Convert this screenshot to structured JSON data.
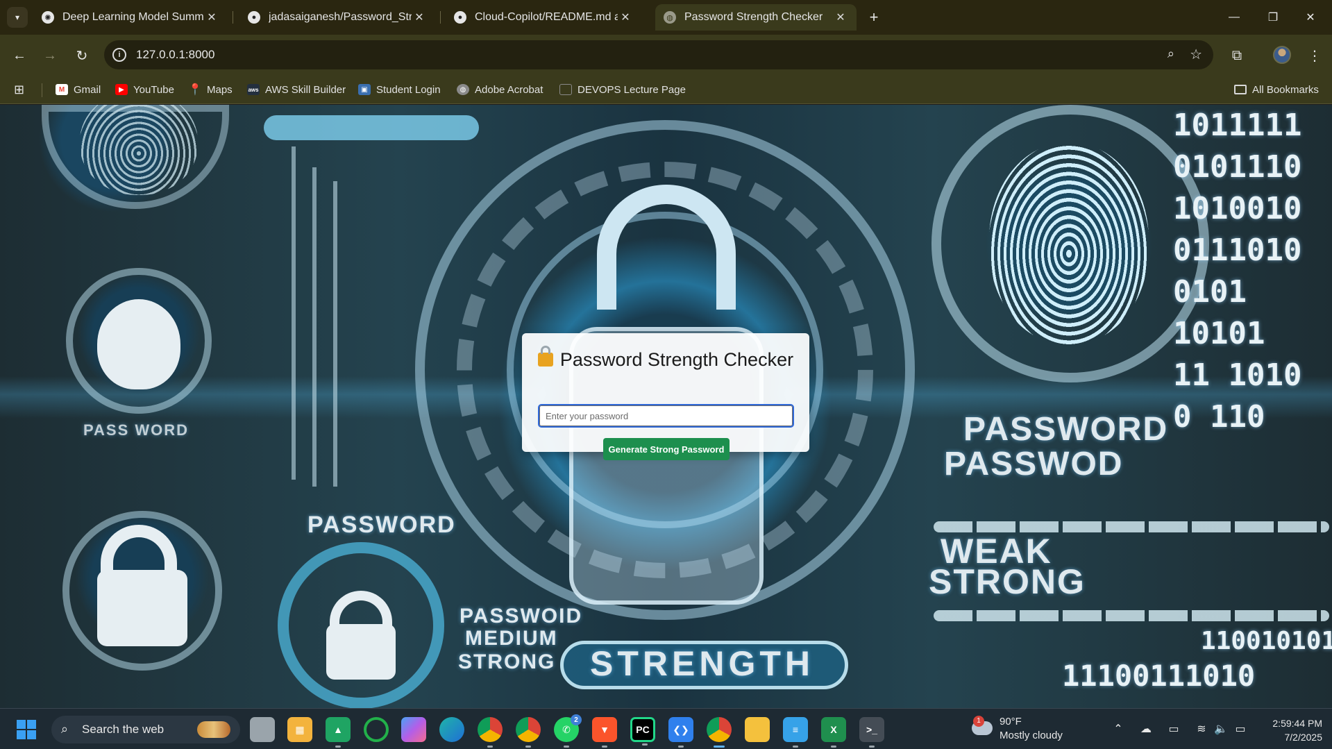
{
  "browser": {
    "tabs": [
      {
        "title": "Deep Learning Model Summary",
        "icon": "openai-icon",
        "active": false
      },
      {
        "title": "jadasaiganesh/Password_Streng",
        "icon": "github-icon",
        "active": false
      },
      {
        "title": "Cloud-Copilot/README.md at m",
        "icon": "github-icon",
        "active": false
      },
      {
        "title": "Password Strength Checker",
        "icon": "globe-icon",
        "active": true
      }
    ],
    "close_glyph": "✕",
    "url": "127.0.0.1:8000",
    "bookmarks": [
      {
        "label": "Gmail",
        "icon": "gmail-icon",
        "color": "#ea4335"
      },
      {
        "label": "YouTube",
        "icon": "youtube-icon",
        "color": "#ff0000"
      },
      {
        "label": "Maps",
        "icon": "maps-icon",
        "color": "#34a853"
      },
      {
        "label": "AWS Skill Builder",
        "icon": "aws-icon",
        "color": "#232f3e"
      },
      {
        "label": "Student Login",
        "icon": "student-icon",
        "color": "#3a6fb0"
      },
      {
        "label": "Adobe Acrobat",
        "icon": "globe-icon",
        "color": "#8a8a8a"
      },
      {
        "label": "DEVOPS Lecture Page",
        "icon": "page-icon",
        "color": "#6b6b6b"
      }
    ],
    "all_bookmarks": "All Bookmarks"
  },
  "background_text": {
    "password_left": "PASSWORD",
    "password_small": "PASS WORD",
    "password_right_1": "PASSWORD",
    "password_right_2": "PASSWOD",
    "weak": "WEAK",
    "strong": "STRONG",
    "passwoid": "PASSWOID",
    "medium": "MEDIUM",
    "strong_small": "STRONG",
    "strength": "STRENGTH",
    "binary_rows": [
      "1011111",
      "0101110",
      "1010010",
      "0111010",
      "0101",
      "10101",
      "11 1010",
      "0 110",
      "110010101",
      "11100111010"
    ]
  },
  "card": {
    "title": "Password Strength Checker",
    "input_placeholder": "Enter your password",
    "button_label": "Generate Strong Password"
  },
  "taskbar": {
    "search_label": "Search the web",
    "apps": [
      {
        "name": "task-view",
        "color": "#9aa4ab"
      },
      {
        "name": "microsoft-store",
        "color": "#f3b33d"
      },
      {
        "name": "google-drive",
        "color": "#1fa463"
      },
      {
        "name": "refresh-app",
        "color": "#22b04a"
      },
      {
        "name": "copilot",
        "color": "#9b5de5"
      },
      {
        "name": "edge",
        "color": "#1f9bd6"
      },
      {
        "name": "chrome-profile",
        "color": "#db4437"
      },
      {
        "name": "chrome",
        "color": "#4285f4"
      },
      {
        "name": "whatsapp",
        "color": "#25d366",
        "badge": "2"
      },
      {
        "name": "brave",
        "color": "#fb542b"
      },
      {
        "name": "pycharm",
        "color": "#21d789"
      },
      {
        "name": "vscode",
        "color": "#2f80ed"
      },
      {
        "name": "chrome-active",
        "color": "#4285f4"
      },
      {
        "name": "file-explorer",
        "color": "#f4c13d"
      },
      {
        "name": "notepad",
        "color": "#36a2e8"
      },
      {
        "name": "excel",
        "color": "#1f8f4e"
      },
      {
        "name": "terminal",
        "color": "#444c55"
      }
    ],
    "weather": {
      "badge": "1",
      "temp": "90°F",
      "desc": "Mostly cloudy"
    },
    "clock": {
      "time": "2:59:44 PM",
      "date": "7/2/2025"
    }
  }
}
